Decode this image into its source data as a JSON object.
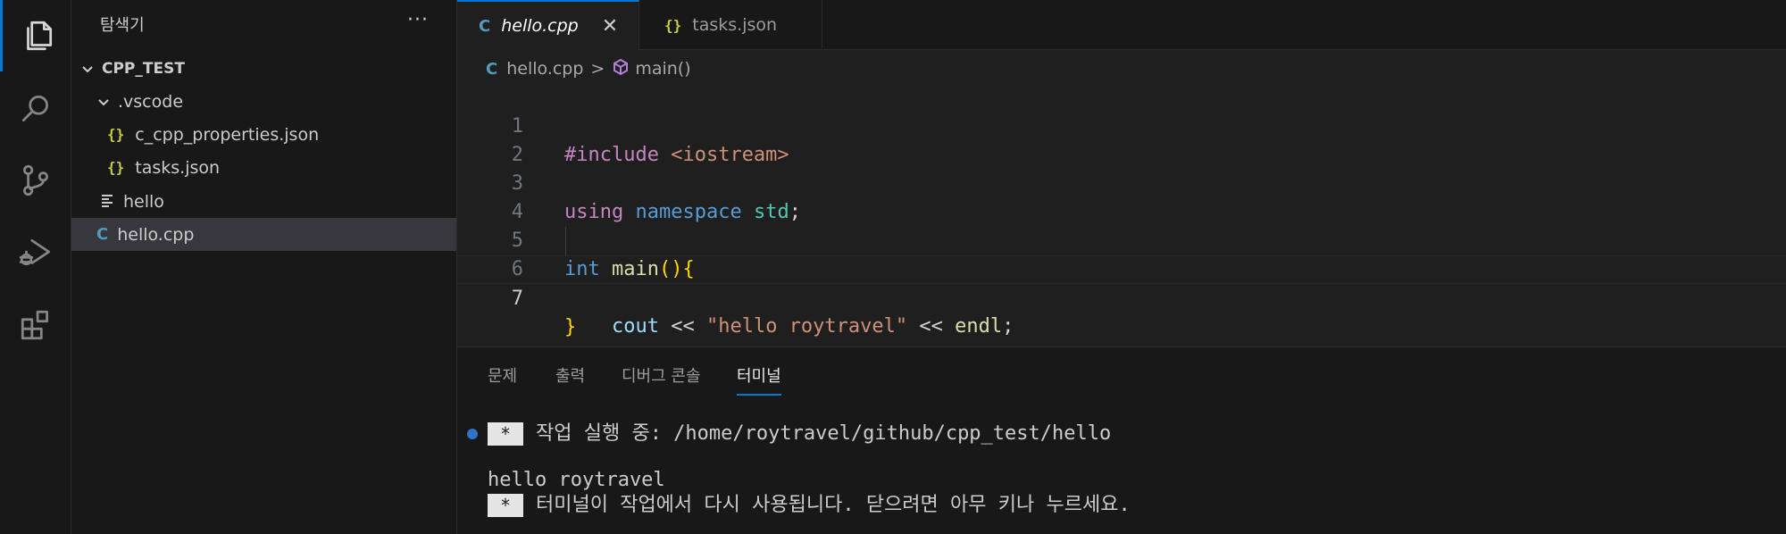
{
  "activity_bar": {
    "items": [
      {
        "name": "explorer",
        "active": true
      },
      {
        "name": "search",
        "active": false
      },
      {
        "name": "source-control",
        "active": false
      },
      {
        "name": "run-and-debug",
        "active": false
      },
      {
        "name": "extensions",
        "active": false
      }
    ]
  },
  "sidebar": {
    "title": "탐색기",
    "more": "···",
    "tree": [
      {
        "label": "CPP_TEST",
        "type": "root"
      },
      {
        "label": ".vscode",
        "type": "folder"
      },
      {
        "label": "c_cpp_properties.json",
        "type": "json"
      },
      {
        "label": "tasks.json",
        "type": "json"
      },
      {
        "label": "hello",
        "type": "file"
      },
      {
        "label": "hello.cpp",
        "type": "cpp",
        "selected": true
      }
    ],
    "json_glyph": "{}",
    "cpp_glyph": "C"
  },
  "tabs": [
    {
      "label": "hello.cpp",
      "active": true,
      "close": "✕"
    },
    {
      "label": "tasks.json",
      "active": false
    }
  ],
  "breadcrumb": {
    "file": "hello.cpp",
    "separator": ">",
    "symbol": "main()"
  },
  "code": {
    "line_numbers": [
      "1",
      "2",
      "3",
      "4",
      "5",
      "6",
      "7"
    ],
    "current_line": "7"
  },
  "panel": {
    "tabs": [
      "문제",
      "출력",
      "디버그 콘솔",
      "터미널"
    ],
    "active_tab": "터미널",
    "terminal": {
      "badge": "*",
      "task_line": "작업 실행 중: /home/roytravel/github/cpp_test/hello",
      "output": "hello roytravel",
      "reuse_line": "터미널이 작업에서 다시 사용됩니다. 닫으려면 아무 키나 누르세요."
    }
  },
  "colors": {
    "accent": "#0078d4",
    "json_icon": "#cbcb41",
    "cpp_icon": "#519aba"
  }
}
